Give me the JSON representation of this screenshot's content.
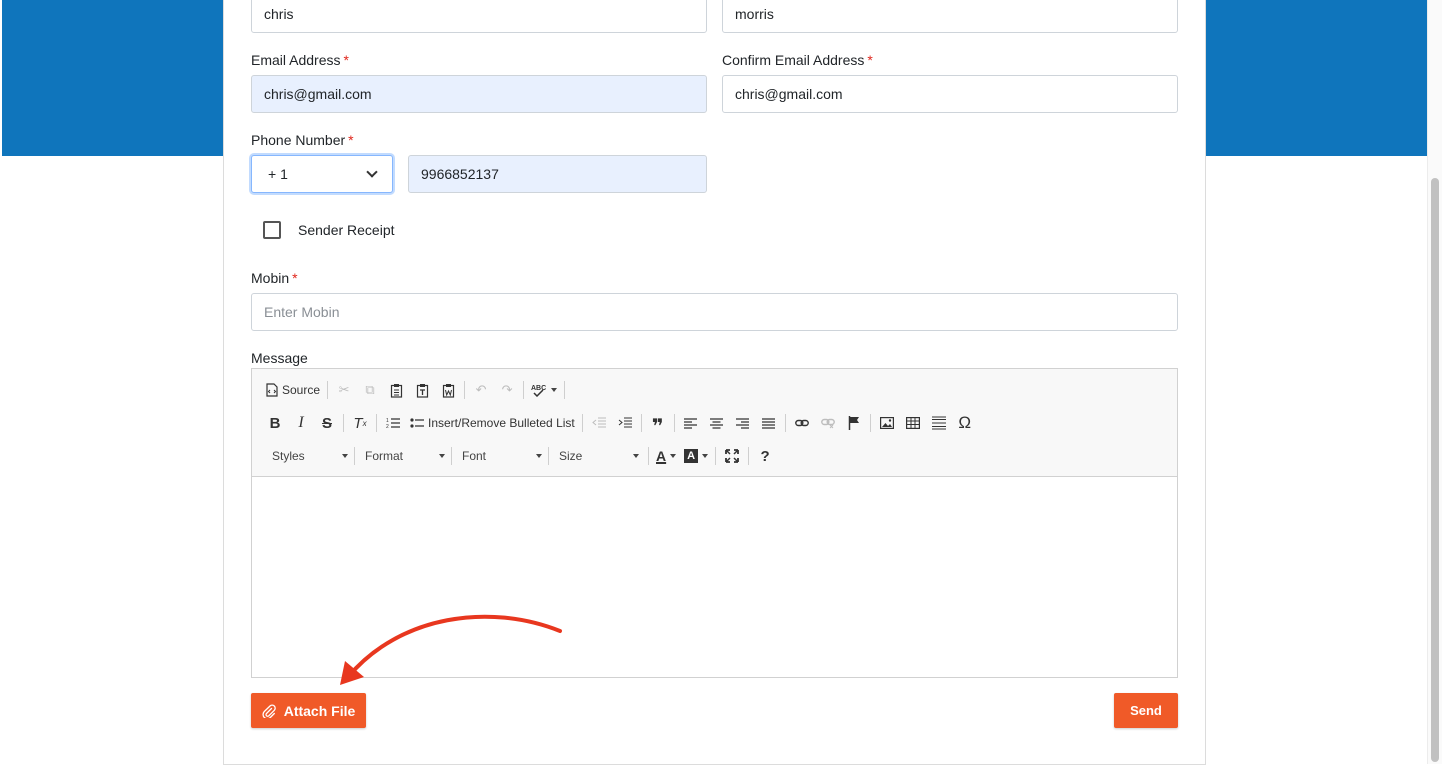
{
  "form": {
    "first_name_value": "chris",
    "last_name_value": "morris",
    "email_label": "Email Address",
    "email_value": "chris@gmail.com",
    "confirm_email_label": "Confirm Email Address",
    "confirm_email_value": "chris@gmail.com",
    "required_mark": "*",
    "phone_label": "Phone Number",
    "phone_code": "+ 1",
    "phone_value": "9966852137",
    "sender_receipt_label": "Sender Receipt",
    "mobin_label": "Mobin",
    "mobin_placeholder": "Enter Mobin",
    "message_label": "Message"
  },
  "editor": {
    "source_label": "Source",
    "bulleted_list_label": "Insert/Remove Bulleted List",
    "styles_label": "Styles",
    "format_label": "Format",
    "font_label": "Font",
    "size_label": "Size",
    "help_label": "?"
  },
  "actions": {
    "attach_label": "Attach File",
    "send_label": "Send"
  },
  "colors": {
    "brand_blue": "#0f75bc",
    "accent_orange": "#f05a28",
    "annotation_arrow": "#e8371f",
    "required_red": "#e0251b"
  }
}
